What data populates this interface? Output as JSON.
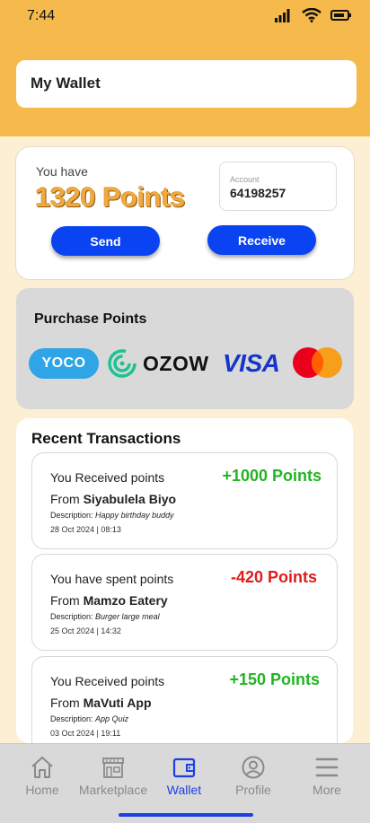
{
  "status_bar": {
    "time": "7:44"
  },
  "header": {
    "title": "My Wallet"
  },
  "balance": {
    "label": "You have",
    "points": "1320 Points",
    "account_label": "Account",
    "account_number": "64198257",
    "send_label": "Send",
    "receive_label": "Receive"
  },
  "purchase": {
    "title": "Purchase Points",
    "providers": [
      {
        "name": "yoco",
        "text": "YOCO",
        "color": "#2fa4e7"
      },
      {
        "name": "ozow",
        "text": "OZOW",
        "color": "#1fc195"
      },
      {
        "name": "visa",
        "text": "VISA",
        "color": "#1434cb"
      },
      {
        "name": "mastercard",
        "text": "",
        "color": "#eb001b"
      }
    ]
  },
  "transactions": {
    "heading": "Recent Transactions",
    "items": [
      {
        "title": "You Received points",
        "amount": "+1000 Points",
        "amount_color": "#22b422",
        "from_prefix": "From ",
        "from_name": "Siyabulela Biyo",
        "desc_label": "Description:",
        "desc_text": "Happy birthday buddy",
        "date": "28 Oct 2024 | 08:13"
      },
      {
        "title": "You have spent points",
        "amount": "-420 Points",
        "amount_color": "#e21b1b",
        "from_prefix": "From ",
        "from_name": "Mamzo Eatery",
        "desc_label": "Description:",
        "desc_text": "Burger large meal",
        "date": "25 Oct 2024 | 14:32"
      },
      {
        "title": "You Received points",
        "amount": "+150 Points",
        "amount_color": "#22b422",
        "from_prefix": "From ",
        "from_name": "MaVuti App",
        "desc_label": "Description:",
        "desc_text": "App Quiz",
        "date": "03 Oct 2024 | 19:11"
      }
    ]
  },
  "nav": {
    "items": [
      {
        "label": "Home",
        "icon": "home-icon"
      },
      {
        "label": "Marketplace",
        "icon": "store-icon"
      },
      {
        "label": "Wallet",
        "icon": "wallet-icon",
        "active": true
      },
      {
        "label": "Profile",
        "icon": "profile-icon"
      },
      {
        "label": "More",
        "icon": "menu-icon"
      }
    ]
  },
  "colors": {
    "header": "#f6b94c",
    "background": "#fcefd4",
    "accent": "#0a44f2",
    "points_gold": "#f1a93e"
  }
}
